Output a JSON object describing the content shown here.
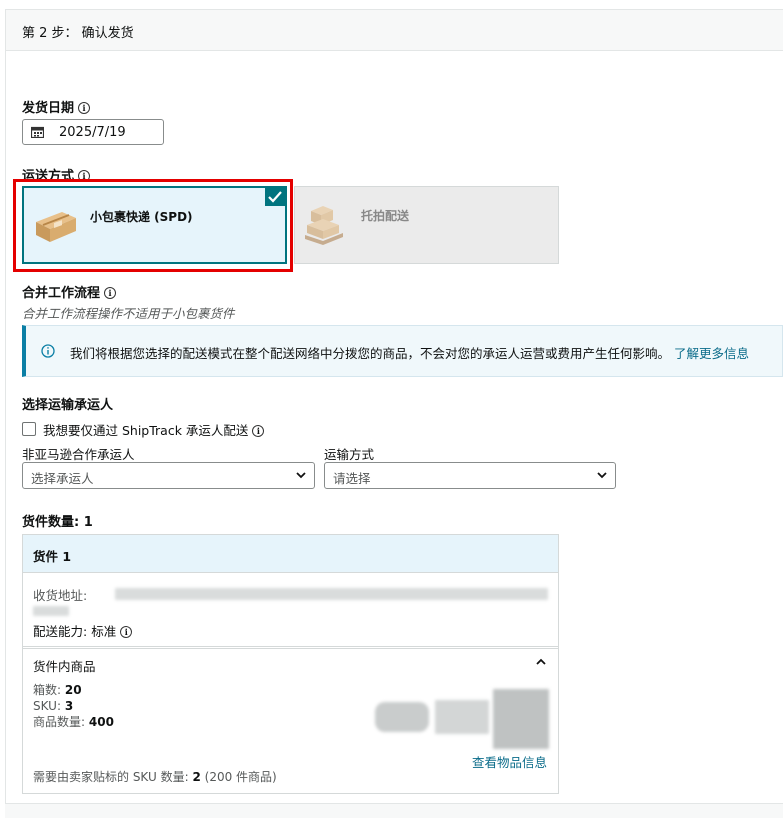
{
  "step": {
    "title": "第 2 步： 确认发货"
  },
  "ship_date": {
    "label": "发货日期",
    "value": "2025/7/19"
  },
  "shipping_method": {
    "label": "运送方式",
    "options": [
      {
        "label": "小包裹快递 (SPD)",
        "selected": true
      },
      {
        "label": "托拍配送",
        "selected": false
      }
    ]
  },
  "consolidation": {
    "label": "合并工作流程",
    "note": "合并工作流程操作不适用于小包裹货件"
  },
  "info_banner": {
    "text": "我们将根据您选择的配送模式在整个配送网络中分拨您的商品，不会对您的承运人运营或费用产生任何影响。",
    "link": "了解更多信息"
  },
  "carrier": {
    "section_title": "选择运输承运人",
    "checkbox_label": "我想要仅通过 ShipTrack 承运人配送",
    "non_partner_label": "非亚马逊合作承运人",
    "non_partner_placeholder": "选择承运人",
    "mode_label": "运输方式",
    "mode_placeholder": "请选择"
  },
  "shipments": {
    "count_label": "货件数量: 1",
    "shipment": {
      "title": "货件 1",
      "address_label": "收货地址:",
      "capability_label": "配送能力:",
      "capability_value": "标准",
      "contents_title": "货件内商品",
      "boxes_label": "箱数:",
      "boxes_value": "20",
      "sku_label": "SKU:",
      "sku_value": "3",
      "qty_label": "商品数量:",
      "qty_value": "400",
      "view_items_link": "查看物品信息",
      "seller_label_text": "需要由卖家贴标的 SKU 数量:",
      "seller_label_count": "2",
      "seller_label_units": "(200 件商品)"
    }
  },
  "colors": {
    "teal": "#00747f",
    "highlight_red": "#e40000",
    "link": "#0b6c8a",
    "selected_bg": "#e6f4fb"
  }
}
